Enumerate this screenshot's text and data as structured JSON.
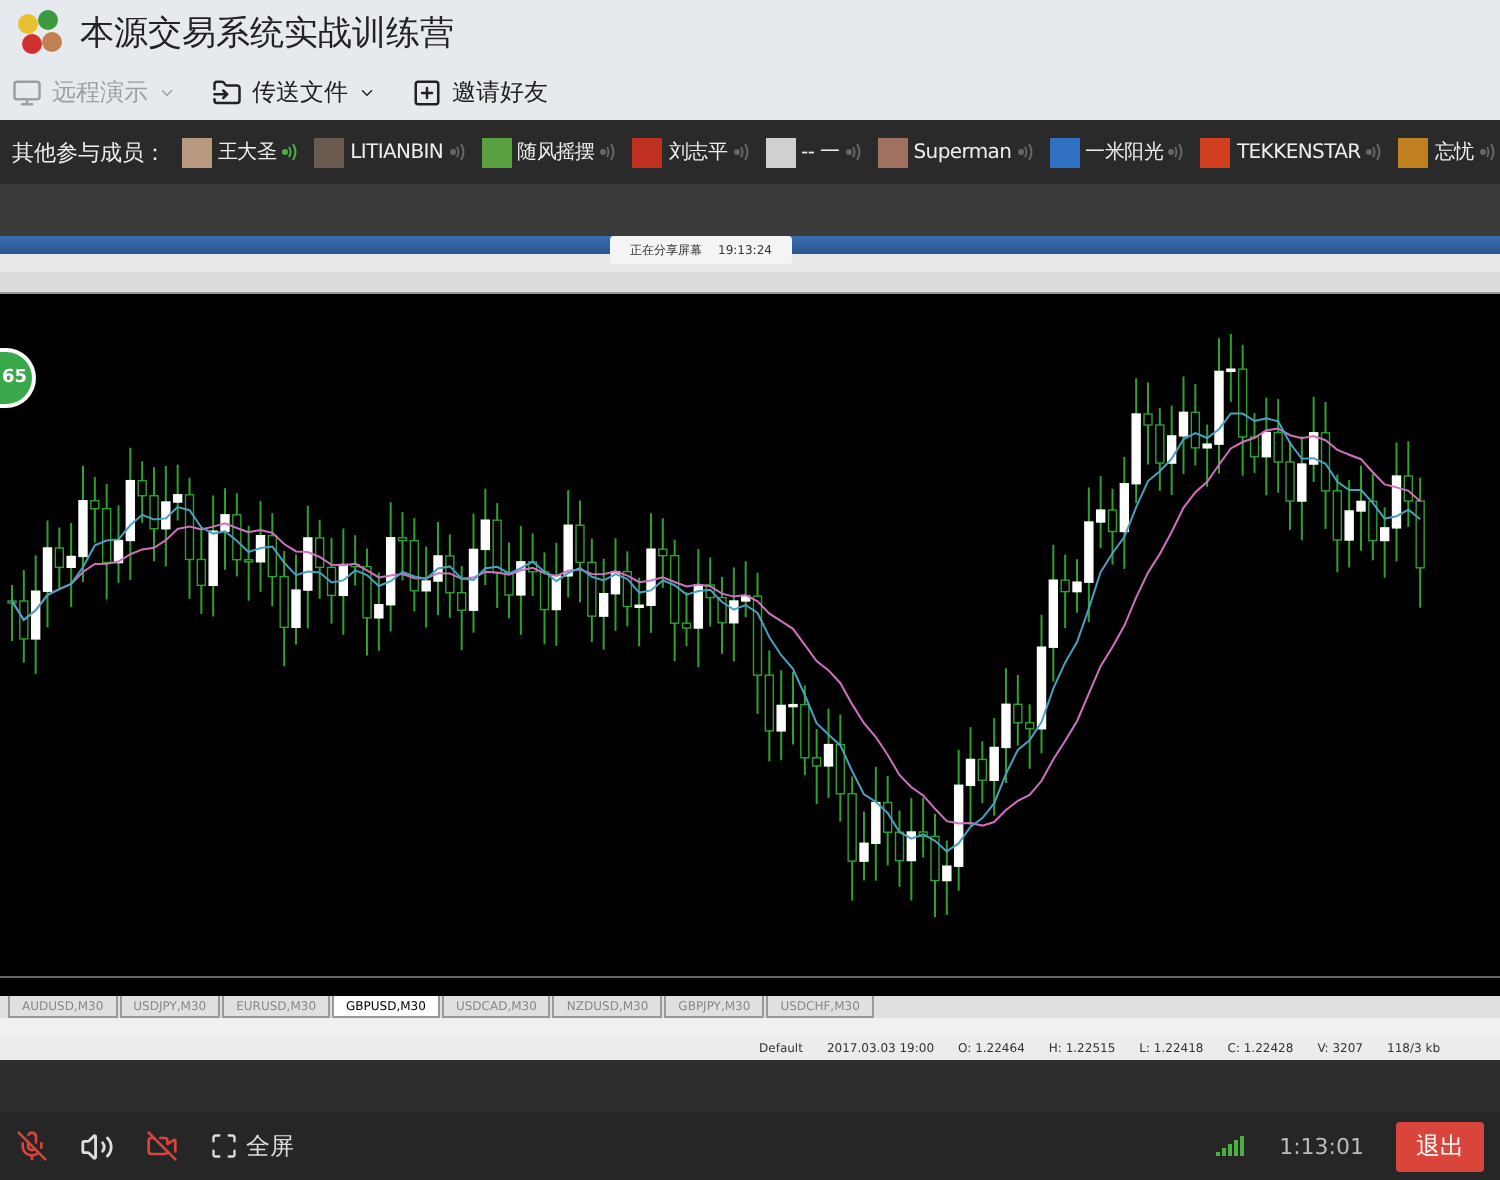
{
  "window": {
    "title": "本源交易系统实战训练营"
  },
  "toolbar": [
    {
      "label": "远程演示",
      "disabled": true,
      "dropdown": true,
      "kind": "screen"
    },
    {
      "label": "传送文件",
      "disabled": false,
      "dropdown": true,
      "kind": "file"
    },
    {
      "label": "邀请好友",
      "disabled": false,
      "dropdown": false,
      "kind": "invite"
    }
  ],
  "members": {
    "label": "其他参与成员：",
    "items": [
      {
        "name": "王大圣",
        "speaking": true,
        "color": "#b89a80"
      },
      {
        "name": "LITIANBIN",
        "speaking": false,
        "color": "#6a5a50"
      },
      {
        "name": "随风摇摆",
        "speaking": false,
        "color": "#5aa040"
      },
      {
        "name": "刘志平",
        "speaking": false,
        "color": "#c03020"
      },
      {
        "name": "-- 一",
        "speaking": false,
        "color": "#d0d0d0"
      },
      {
        "name": "Superman",
        "speaking": false,
        "color": "#a07060"
      },
      {
        "name": "一米阳光",
        "speaking": false,
        "color": "#3070c0"
      },
      {
        "name": "TEKKENSTAR",
        "speaking": false,
        "color": "#d04020"
      },
      {
        "name": "忘忧",
        "speaking": false,
        "color": "#c08020"
      }
    ]
  },
  "shared_screen": {
    "notice": "正在分享屏幕",
    "notice_time": "19:13:24",
    "badge": "65",
    "symbol_tabs": [
      {
        "label": "AUDUSD,M30",
        "selected": false
      },
      {
        "label": "USDJPY,M30",
        "selected": false
      },
      {
        "label": "EURUSD,M30",
        "selected": false
      },
      {
        "label": "GBPUSD,M30",
        "selected": true
      },
      {
        "label": "USDCAD,M30",
        "selected": false
      },
      {
        "label": "NZDUSD,M30",
        "selected": false
      },
      {
        "label": "GBPJPY,M30",
        "selected": false
      },
      {
        "label": "USDCHF,M30",
        "selected": false
      }
    ],
    "status_bar": [
      "Default",
      "2017.03.03 19:00",
      "O: 1.22464",
      "H: 1.22515",
      "L: 1.22418",
      "C: 1.22428",
      "V: 3207",
      "118/3 kb"
    ]
  },
  "controls": {
    "mic_muted": true,
    "camera_off": true,
    "fullscreen": "全屏",
    "elapsed": "1:13:01",
    "exit": "退出"
  }
}
